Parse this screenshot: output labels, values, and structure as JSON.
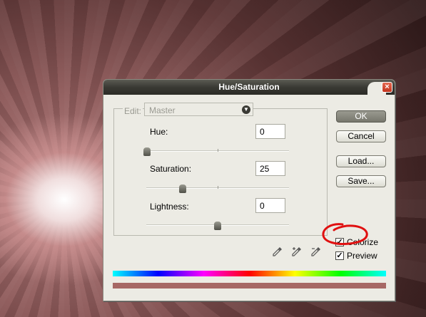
{
  "dialog": {
    "title": "Hue/Saturation",
    "close_glyph": "×"
  },
  "edit": {
    "label": "Edit:",
    "selected": "Master"
  },
  "sliders": [
    {
      "label": "Hue:",
      "value": "0",
      "position": 0.0
    },
    {
      "label": "Saturation:",
      "value": "25",
      "position": 0.25
    },
    {
      "label": "Lightness:",
      "value": "0",
      "position": 0.5
    }
  ],
  "buttons": {
    "ok": "OK",
    "cancel": "Cancel",
    "load": "Load...",
    "save": "Save..."
  },
  "options": {
    "colorize": {
      "label": "Colorize",
      "checked": true
    },
    "preview": {
      "label": "Preview",
      "checked": true
    },
    "check_glyph": "✓"
  },
  "eyedroppers": [
    "eyedropper-icon",
    "eyedropper-plus-icon",
    "eyedropper-minus-icon"
  ],
  "colors": {
    "result_bar": "#a66865",
    "annotation": "#e01010"
  }
}
